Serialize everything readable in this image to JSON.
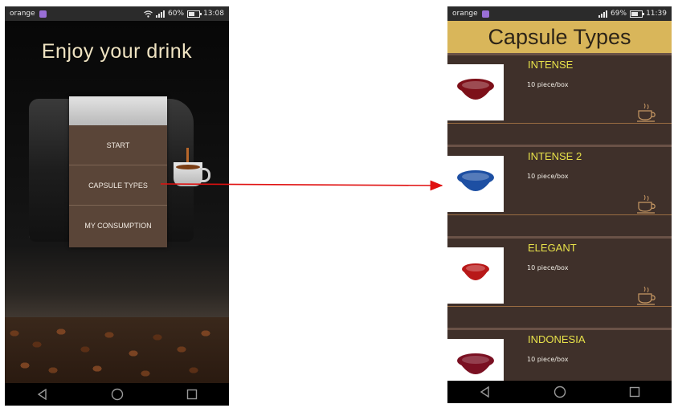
{
  "left_phone": {
    "status": {
      "carrier": "orange",
      "battery": "60%",
      "time": "13:08",
      "battery_level": 0.6
    },
    "title": "Enjoy your drink",
    "menu": [
      "START",
      "CAPSULE TYPES",
      "MY CONSUMPTION"
    ]
  },
  "right_phone": {
    "status": {
      "carrier": "orange",
      "battery": "69%",
      "time": "11:39",
      "battery_level": 0.69
    },
    "header": "Capsule Types",
    "capsules": [
      {
        "name": "INTENSE",
        "pieces": "10 piece/box",
        "capsule_color": "#7d1019"
      },
      {
        "name": "INTENSE 2",
        "pieces": "10 piece/box",
        "capsule_color": "#1d4fa3"
      },
      {
        "name": "ELEGANT",
        "pieces": "10 piece/box",
        "capsule_color": "#b81818"
      },
      {
        "name": "INDONESIA",
        "pieces": "10 piece/box",
        "capsule_color": "#7a1022"
      }
    ]
  },
  "colors": {
    "header_gold": "#d9b65a",
    "list_bg": "#3f302a",
    "capsule_name": "#e8e24a",
    "price_red": "#c8291f",
    "menu_brown": "#5a4538",
    "arrow_red": "#e01010"
  },
  "icons": [
    "wifi-icon",
    "signal-icon",
    "battery-icon",
    "coffee-cup-icon",
    "back-icon",
    "home-icon",
    "recents-icon"
  ]
}
